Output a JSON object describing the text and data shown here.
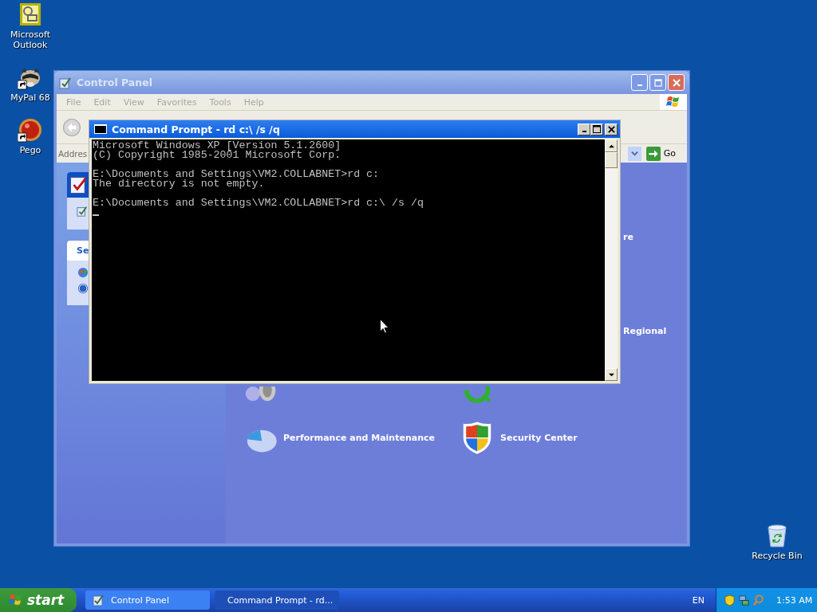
{
  "desktop_icons": [
    {
      "label": "Microsoft Outlook",
      "kind": "mail",
      "shortcut": false
    },
    {
      "label": "MyPal 68",
      "kind": "raccoon",
      "shortcut": true
    },
    {
      "label": "Pego",
      "kind": "ball",
      "shortcut": true
    }
  ],
  "recycle_bin": {
    "label": "Recycle Bin"
  },
  "control_panel": {
    "title": "Control Panel",
    "active": false,
    "menu": [
      "File",
      "Edit",
      "View",
      "Favorites",
      "Tools",
      "Help"
    ],
    "address_label": "Addres",
    "go": "Go",
    "see_also_heading": "Se",
    "fragments": [
      "re",
      "Regional"
    ],
    "categories": [
      {
        "kind": "speaker"
      },
      {
        "kind": "accessibility"
      },
      {
        "label": "Performance and Maintenance",
        "kind": "pie"
      },
      {
        "label": "Security Center",
        "kind": "shield"
      }
    ]
  },
  "command_prompt": {
    "title": "Command Prompt - rd c:\\ /s /q",
    "active": true,
    "cursor": true,
    "blocks": [
      [
        "Microsoft Windows XP [Version 5.1.2600]",
        "(C) Copyright 1985-2001 Microsoft Corp."
      ],
      [
        "E:\\Documents and Settings\\VM2.COLLABNET>rd c:",
        "The directory is not empty."
      ],
      [
        "E:\\Documents and Settings\\VM2.COLLABNET>rd c:\\ /s /q"
      ]
    ]
  },
  "taskbar": {
    "start": "start",
    "tasks": [
      {
        "label": "Control Panel",
        "kind": "folder",
        "selected": false
      },
      {
        "label": "Command Prompt - rd...",
        "kind": "console",
        "selected": true
      }
    ],
    "language": "EN",
    "clock": "1:53 AM"
  }
}
